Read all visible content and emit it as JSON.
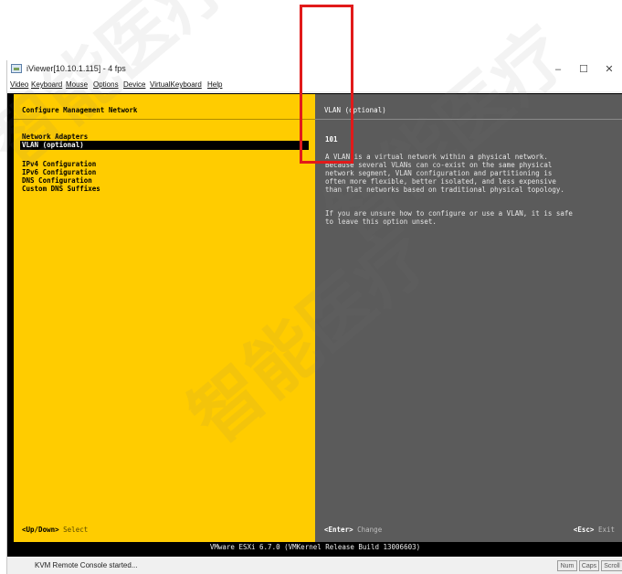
{
  "window": {
    "title": "iViewer[10.10.1.115] - 4 fps",
    "controls": {
      "minimize": "–",
      "maximize": "☐",
      "close": "✕"
    }
  },
  "menu": [
    "Video",
    "Keyboard",
    "Mouse",
    "Options",
    "Device",
    "VirtualKeyboard",
    "Help"
  ],
  "left_pane": {
    "header": "Configure Management Network",
    "items": [
      {
        "label": "Network Adapters",
        "selected": false
      },
      {
        "label": "VLAN (optional)",
        "selected": true
      },
      {
        "label": "IPv4 Configuration",
        "selected": false
      },
      {
        "label": "IPv6 Configuration",
        "selected": false
      },
      {
        "label": "DNS Configuration",
        "selected": false
      },
      {
        "label": "Custom DNS Suffixes",
        "selected": false
      }
    ],
    "footer_key": "<Up/Down>",
    "footer_action": "Select"
  },
  "right_pane": {
    "header": "VLAN (optional)",
    "value": "101",
    "description": [
      "A VLAN is a virtual network within a physical network.",
      "Because several VLANs can co-exist on the same physical",
      "network segment, VLAN configuration and partitioning is",
      "often more flexible, better isolated, and less expensive",
      "than flat networks based on traditional physical topology."
    ],
    "note": [
      "If you are unsure how to configure or use a VLAN, it is safe",
      "to leave this option unset."
    ],
    "enter_key": "<Enter>",
    "enter_action": "Change",
    "esc_key": "<Esc>",
    "esc_action": "Exit"
  },
  "bottom_bar": "VMware ESXi 6.7.0 (VMKernel Release Build 13006603)",
  "status": {
    "text": "KVM Remote Console started...",
    "locks": [
      "Num",
      "Caps",
      "Scroll"
    ]
  },
  "colors": {
    "left_pane_bg": "#ffcc00",
    "right_pane_bg": "#5b5b5b",
    "highlight_box": "#e11a1a"
  }
}
